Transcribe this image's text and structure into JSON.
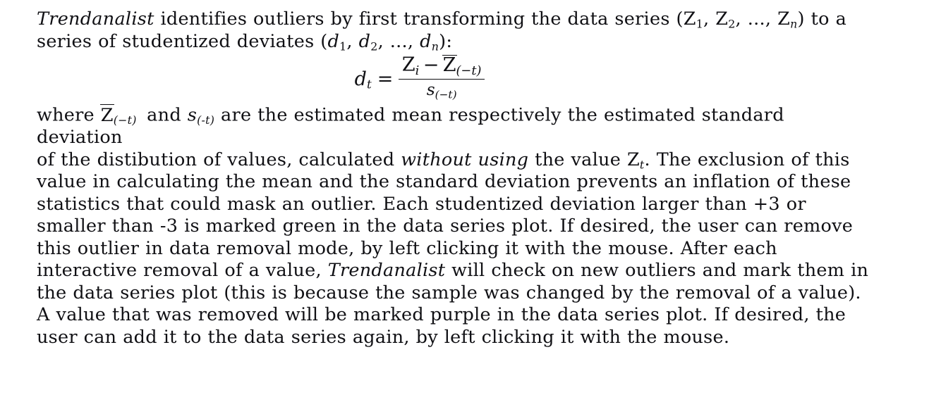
{
  "document": {
    "paragraph_1": {
      "app_name": "Trendanalist",
      "text_after_name": " identifies outliers by first transforming the data series (Z",
      "sub_1": "1",
      "text_2": ", Z",
      "sub_2": "2",
      "text_3": ", ..., Z",
      "sub_n": "n",
      "text_4": ") to a series of studentized deviates (",
      "d_1": "d",
      "d_sub_1": "1",
      "text_5": ", ",
      "d_2": "d",
      "d_sub_2": "2",
      "text_6": ", ..., ",
      "d_n": "d",
      "d_sub_n": "n",
      "text_7": "):"
    },
    "equation": {
      "lhs_symbol": "d",
      "lhs_subscript": "t",
      "equals": "=",
      "numerator_z1": "Z",
      "numerator_z1_sub": "i",
      "numerator_minus": "−",
      "numerator_z2": "Z",
      "numerator_z2_sub": "(−t)",
      "denominator_s": "s",
      "denominator_s_sub": "(−t)",
      "latex": "d_t = (Z_i - \\overline{Z}_{(-t)}) / s_{(-t)}"
    },
    "paragraph_2": {
      "where_word": "where ",
      "zbar_symbol": "Z",
      "zbar_subscript": "(−t)",
      "and_word": " and ",
      "s_symbol": "s",
      "s_subscript": "(-t)",
      "rest": " are the estimated mean respectively the estimated standard deviation"
    },
    "paragraph_3": {
      "segment_1": "of the distibution of values, calculated ",
      "italic_1": "without using",
      "segment_2": " the value Z",
      "z_subscript": "t",
      "segment_3": ". The exclusion of this value in calculating the mean and the standard deviation prevents an inflation of these statistics that could mask an outlier. Each studentized deviation larger than +3 or smaller than -3 is marked green in the data series plot. If desired, the user can remove this outlier in data removal mode, by left clicking it with the mouse. After each interactive removal of a value, ",
      "italic_2": "Trendanalist",
      "segment_4": " will check on new outliers and mark them in the data series plot (this is because the sample was changed by the removal of a value). A value that was removed will be marked purple in the data series plot. If desired, the user can add it to the data series again, by left clicking it with the mouse."
    }
  },
  "colors": {
    "text": "#101014",
    "background": "#ffffff"
  }
}
